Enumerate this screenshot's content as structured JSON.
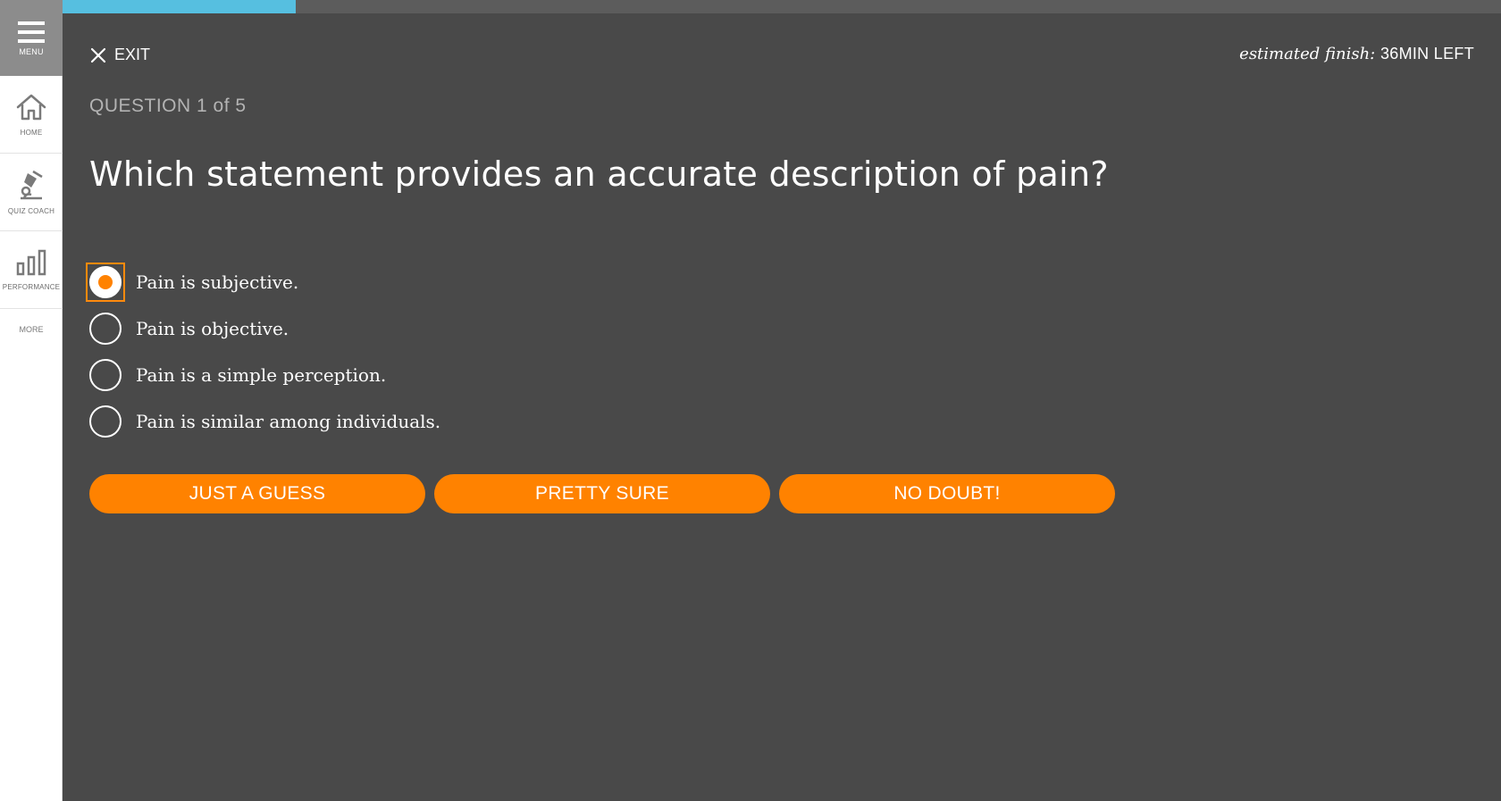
{
  "sidebar": {
    "menu_label": "MENU",
    "items": [
      {
        "label": "HOME",
        "icon": "home-icon"
      },
      {
        "label": "QUIZ COACH",
        "icon": "quiz-coach-icon"
      },
      {
        "label": "PERFORMANCE",
        "icon": "bar-chart-icon"
      }
    ],
    "more_label": "MORE"
  },
  "progress": {
    "fraction": 0.2
  },
  "header": {
    "exit_label": "EXIT",
    "estimate_prefix": "estimated finish:",
    "estimate_value": "36MIN LEFT"
  },
  "quiz": {
    "question_counter": "QUESTION 1 of 5",
    "question_text": "Which statement provides an accurate description of pain?",
    "selected_index": 0,
    "options": [
      "Pain is subjective.",
      "Pain is objective.",
      "Pain is a simple perception.",
      "Pain is similar among individuals."
    ]
  },
  "confidence_buttons": [
    "JUST A GUESS",
    "PRETTY SURE",
    "NO DOUBT!"
  ],
  "colors": {
    "background": "#494949",
    "accent": "#ff8200",
    "progress_fill": "#56bfe0"
  }
}
